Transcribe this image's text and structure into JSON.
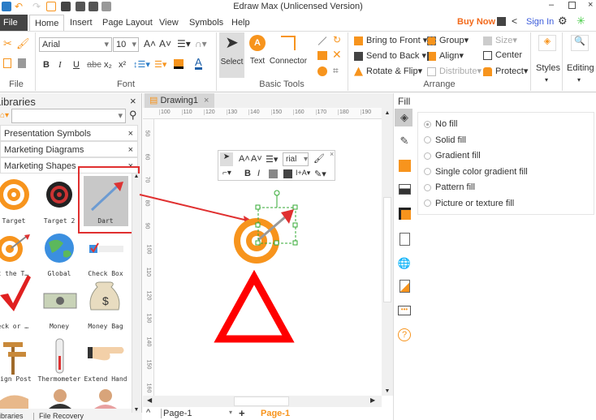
{
  "window": {
    "title": "Edraw Max (Unlicensed Version)"
  },
  "menu": {
    "tabs": [
      "File",
      "Home",
      "Insert",
      "Page Layout",
      "View",
      "Symbols",
      "Help"
    ],
    "active": "Home",
    "buy_now": "Buy Now",
    "sign_in": "Sign In"
  },
  "ribbon": {
    "file_label": "File",
    "font": {
      "family": "Arial",
      "size": "10",
      "label": "Font"
    },
    "basic_tools": {
      "select": "Select",
      "text": "Text",
      "connector": "Connector",
      "label": "Basic Tools"
    },
    "arrange": {
      "bring_front": "Bring to Front",
      "send_back": "Send to Back",
      "rotate_flip": "Rotate & Flip",
      "group": "Group",
      "align": "Align",
      "distribute": "Distribute",
      "size": "Size",
      "center": "Center",
      "protect": "Protect",
      "label": "Arrange"
    },
    "styles": "Styles",
    "editing": "Editing"
  },
  "libraries": {
    "title": "Libraries",
    "search_value": "",
    "sections": [
      "Presentation Symbols",
      "Marketing Diagrams",
      "Marketing Shapes"
    ],
    "shapes": [
      "Target",
      "Target 2",
      "Dart",
      "Hit the T…",
      "Global",
      "Check Box",
      "Check or …",
      "Money",
      "Money Bag",
      "Sign Post",
      "Thermometer",
      "Extend Hand"
    ],
    "selected": "Dart",
    "bottom_tabs": [
      "Libraries",
      "File Recovery"
    ]
  },
  "document": {
    "tab": "Drawing1",
    "hruler": [
      "100",
      "110",
      "120",
      "130",
      "140",
      "150",
      "160",
      "170",
      "180",
      "190"
    ],
    "vruler": [
      "50",
      "60",
      "70",
      "80",
      "90",
      "100",
      "110",
      "120",
      "130",
      "140",
      "150",
      "160"
    ],
    "mini_toolbar": {
      "font": "rial"
    }
  },
  "pages": {
    "current": "Page-1",
    "tab": "Page-1"
  },
  "fill_panel": {
    "title": "Fill",
    "options": [
      "No fill",
      "Solid fill",
      "Gradient fill",
      "Single color gradient fill",
      "Pattern fill",
      "Picture or texture fill"
    ],
    "selected": "No fill"
  },
  "colors": {
    "accent": "#f7941d",
    "buy_now": "#f26a1b",
    "sign_in": "#3b5bdb",
    "highlight": "#e03030"
  }
}
